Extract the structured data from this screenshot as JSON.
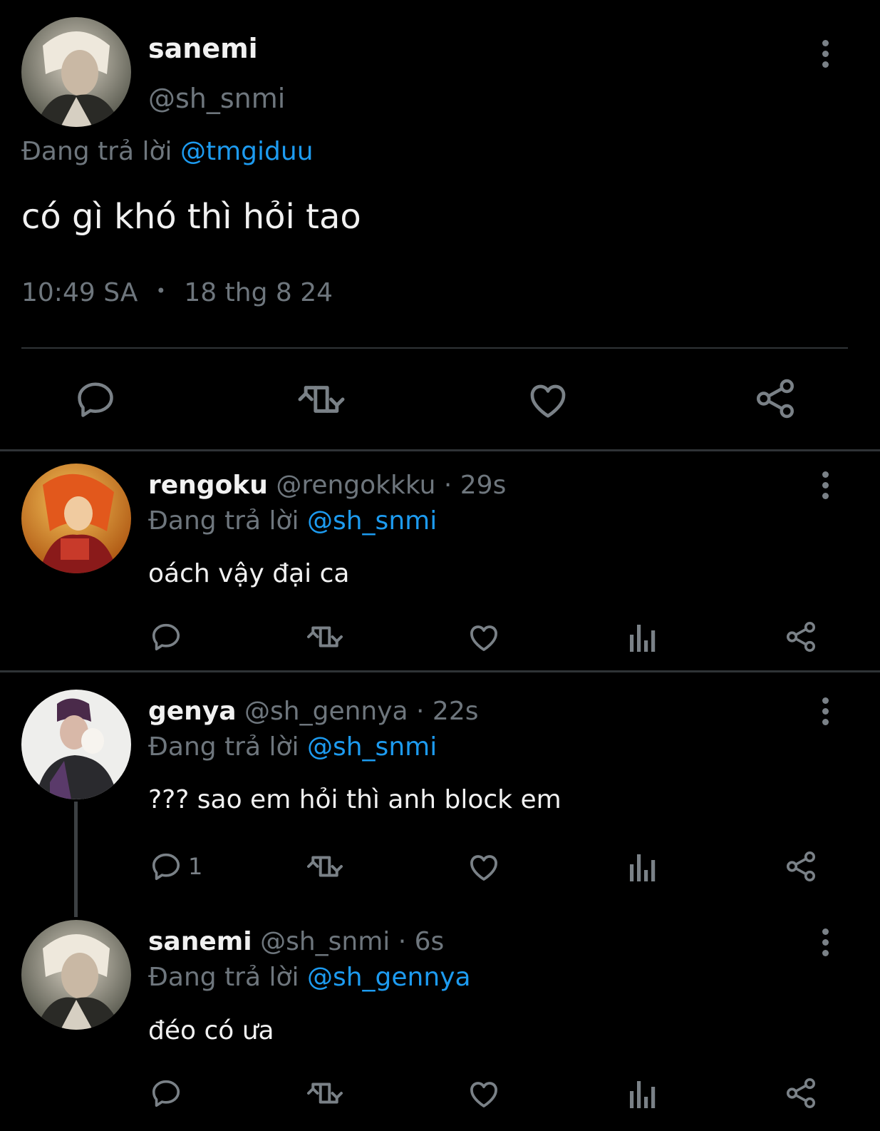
{
  "main_tweet": {
    "display_name": "sanemi",
    "handle": "@sh_snmi",
    "reply_prefix": "Đang trả lời",
    "reply_to": "@tmgiduu",
    "text": "có gì khó thì hỏi tao",
    "time": "10:49 SA",
    "separator": "•",
    "date": "18 thg 8 24"
  },
  "replies": [
    {
      "display_name": "rengoku",
      "meta": "@rengokkku · 29s",
      "reply_prefix": "Đang trả lời",
      "reply_to": "@sh_snmi",
      "text": "oách vậy đại ca",
      "reply_count": ""
    },
    {
      "display_name": "genya",
      "meta": "@sh_gennya · 22s",
      "reply_prefix": "Đang trả lời",
      "reply_to": "@sh_snmi",
      "text": "??? sao em hỏi thì anh block em",
      "reply_count": "1"
    },
    {
      "display_name": "sanemi",
      "meta": "@sh_snmi · 6s",
      "reply_prefix": "Đang trả lời",
      "reply_to": "@sh_gennya",
      "text": "đéo có ưa",
      "reply_count": ""
    }
  ],
  "colors": {
    "background": "#000000",
    "link": "#1d9bf0",
    "muted": "#6e767d",
    "icon": "#7a8187"
  },
  "icons": [
    "reply-icon",
    "retweet-icon",
    "like-icon",
    "views-icon",
    "share-icon",
    "more-icon"
  ]
}
